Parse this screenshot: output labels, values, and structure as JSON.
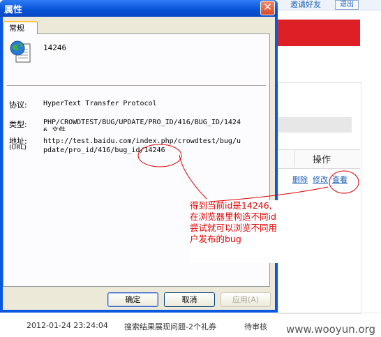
{
  "background": {
    "top_links": [
      "邀请好友",
      "退出"
    ],
    "table_header": "操作",
    "row_actions": [
      "删除",
      "修改",
      "查看"
    ],
    "row": {
      "time": "2012-01-24 23:24:04",
      "title": "搜索结果展现问题-2个礼券",
      "status": "待审核"
    },
    "watermark": "www.wooyun.org",
    "accent_color": "#dd1f26"
  },
  "dialog": {
    "title": "属性",
    "tab": "常规",
    "file_name": "14246",
    "file_icon": "globe-document-icon",
    "properties": [
      {
        "label": "协议:",
        "lines": [
          "HyperText Transfer Protocol"
        ]
      },
      {
        "label": "类型:",
        "lines": [
          "PHP/CROWDTEST/BUG/UPDATE/PRO_ID/416/BUG_ID/1424",
          "6 文件"
        ]
      },
      {
        "label": "地址:",
        "label2": "(URL)",
        "lines": [
          "http://test.baidu.com/index.php/crowdtest/bug/u",
          "pdate/pro_id/416/bug_id/14246"
        ]
      }
    ],
    "buttons": {
      "ok": "确定",
      "cancel": "取消",
      "apply": "应用(A)"
    }
  },
  "annotation": {
    "lines": [
      "得到当前id是14246,",
      "在浏览器里构造不同id",
      "尝试就可以浏览不同用",
      "户发布的bug"
    ],
    "color": "#e00000"
  }
}
